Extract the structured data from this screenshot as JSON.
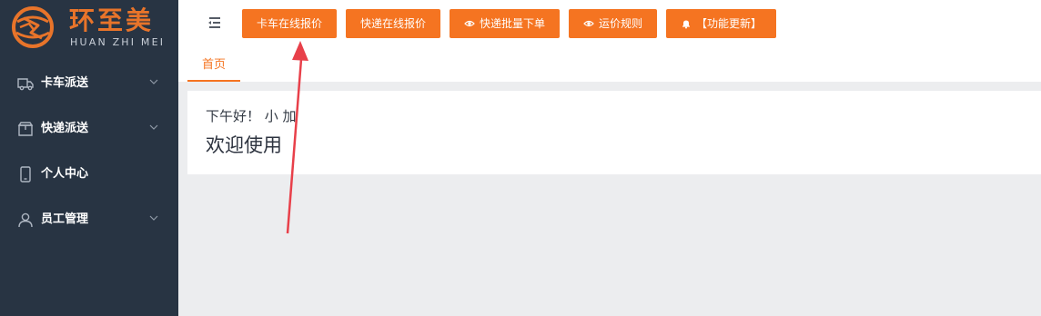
{
  "brand": {
    "name": "环至美",
    "subtitle": "HUAN ZHI MEI",
    "color": "#e8742a"
  },
  "sidebar": {
    "items": [
      {
        "label": "卡车派送",
        "icon": "truck-icon",
        "expandable": true
      },
      {
        "label": "快递派送",
        "icon": "package-icon",
        "expandable": true
      },
      {
        "label": "个人中心",
        "icon": "phone-icon",
        "expandable": false
      },
      {
        "label": "员工管理",
        "icon": "user-icon",
        "expandable": true
      }
    ]
  },
  "toolbar": {
    "buttons": [
      {
        "label": "卡车在线报价",
        "icon": ""
      },
      {
        "label": "快递在线报价",
        "icon": ""
      },
      {
        "label": "快递批量下单",
        "icon": "eye-icon"
      },
      {
        "label": "运价规则",
        "icon": "eye-icon"
      },
      {
        "label": "【功能更新】",
        "icon": "bell-icon"
      }
    ],
    "accent": "#f57421"
  },
  "tabs": [
    {
      "label": "首页",
      "active": true
    }
  ],
  "welcome": {
    "greeting": "下午好！ 小 加",
    "message": "欢迎使用"
  },
  "annotation": {
    "type": "arrow",
    "color": "#e8404a"
  }
}
